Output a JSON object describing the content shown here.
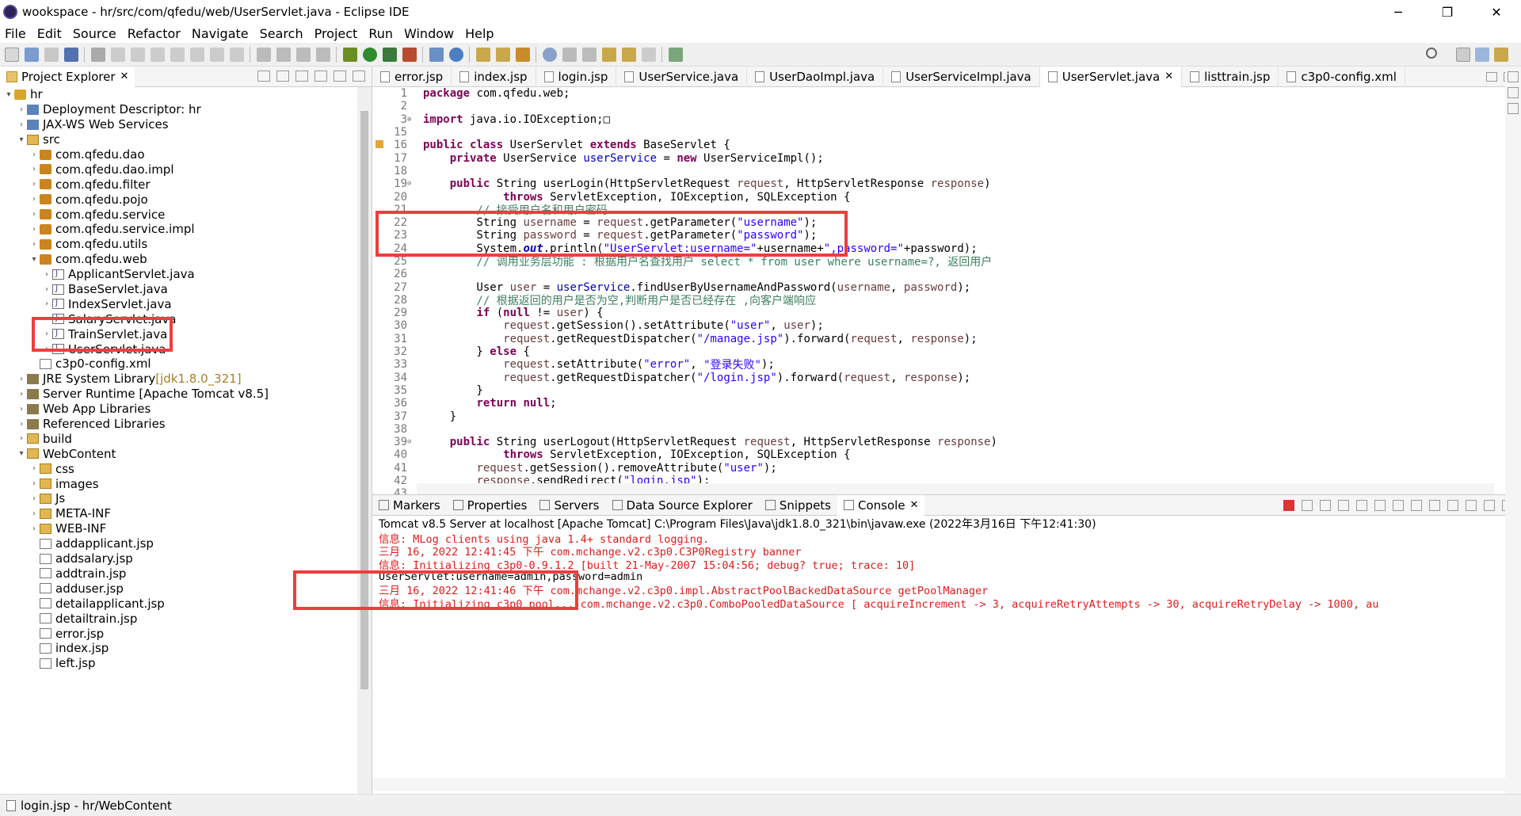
{
  "window": {
    "title": "wookspace - hr/src/com/qfedu/web/UserServlet.java - Eclipse IDE"
  },
  "menu": [
    "File",
    "Edit",
    "Source",
    "Refactor",
    "Navigate",
    "Search",
    "Project",
    "Run",
    "Window",
    "Help"
  ],
  "explorer": {
    "tab_label": "Project Explorer",
    "tree": [
      {
        "label": "hr",
        "icon": "project",
        "arrow": "v"
      },
      {
        "label": "Deployment Descriptor: hr",
        "icon": "web",
        "arrow": ">"
      },
      {
        "label": "JAX-WS Web Services",
        "icon": "web",
        "arrow": ">"
      },
      {
        "label": "src",
        "icon": "folder",
        "arrow": "v"
      },
      {
        "label": "com.qfedu.dao",
        "icon": "package",
        "arrow": ">"
      },
      {
        "label": "com.qfedu.dao.impl",
        "icon": "package",
        "arrow": ">"
      },
      {
        "label": "com.qfedu.filter",
        "icon": "package",
        "arrow": ">"
      },
      {
        "label": "com.qfedu.pojo",
        "icon": "package",
        "arrow": ">"
      },
      {
        "label": "com.qfedu.service",
        "icon": "package",
        "arrow": ">"
      },
      {
        "label": "com.qfedu.service.impl",
        "icon": "package",
        "arrow": ">"
      },
      {
        "label": "com.qfedu.utils",
        "icon": "package",
        "arrow": ">"
      },
      {
        "label": "com.qfedu.web",
        "icon": "package",
        "arrow": "v"
      },
      {
        "label": "ApplicantServlet.java",
        "icon": "java",
        "arrow": ">"
      },
      {
        "label": "BaseServlet.java",
        "icon": "java",
        "arrow": ">"
      },
      {
        "label": "IndexServlet.java",
        "icon": "java",
        "arrow": ">"
      },
      {
        "label": "SalaryServlet.java",
        "icon": "java",
        "arrow": ">"
      },
      {
        "label": "TrainServlet.java",
        "icon": "java",
        "arrow": ">"
      },
      {
        "label": "UserServlet.java",
        "icon": "java",
        "arrow": ">"
      },
      {
        "label": "c3p0-config.xml",
        "icon": "file",
        "arrow": ""
      },
      {
        "label": "JRE System Library",
        "extra": "[jdk1.8.0_321]",
        "icon": "library",
        "arrow": ">"
      },
      {
        "label": "Server Runtime [Apache Tomcat v8.5]",
        "icon": "library",
        "arrow": ">"
      },
      {
        "label": "Web App Libraries",
        "icon": "library",
        "arrow": ">"
      },
      {
        "label": "Referenced Libraries",
        "icon": "library",
        "arrow": ">"
      },
      {
        "label": "build",
        "icon": "folder",
        "arrow": ">"
      },
      {
        "label": "WebContent",
        "icon": "folder",
        "arrow": "v"
      },
      {
        "label": "css",
        "icon": "folder",
        "arrow": ">"
      },
      {
        "label": "images",
        "icon": "folder",
        "arrow": ">"
      },
      {
        "label": "Js",
        "icon": "folder",
        "arrow": ">"
      },
      {
        "label": "META-INF",
        "icon": "folder",
        "arrow": ">"
      },
      {
        "label": "WEB-INF",
        "icon": "folder",
        "arrow": ">"
      },
      {
        "label": "addapplicant.jsp",
        "icon": "file",
        "arrow": ""
      },
      {
        "label": "addsalary.jsp",
        "icon": "file",
        "arrow": ""
      },
      {
        "label": "addtrain.jsp",
        "icon": "file",
        "arrow": ""
      },
      {
        "label": "adduser.jsp",
        "icon": "file",
        "arrow": ""
      },
      {
        "label": "detailapplicant.jsp",
        "icon": "file",
        "arrow": ""
      },
      {
        "label": "detailtrain.jsp",
        "icon": "file",
        "arrow": ""
      },
      {
        "label": "error.jsp",
        "icon": "file",
        "arrow": ""
      },
      {
        "label": "index.jsp",
        "icon": "file",
        "arrow": ""
      },
      {
        "label": "left.jsp",
        "icon": "file",
        "arrow": ""
      }
    ]
  },
  "editor": {
    "tabs": [
      {
        "label": "error.jsp",
        "active": false
      },
      {
        "label": "index.jsp",
        "active": false
      },
      {
        "label": "login.jsp",
        "active": false
      },
      {
        "label": "UserService.java",
        "active": false
      },
      {
        "label": "UserDaoImpl.java",
        "active": false
      },
      {
        "label": "UserServiceImpl.java",
        "active": false
      },
      {
        "label": "UserServlet.java",
        "active": true
      },
      {
        "label": "listtrain.jsp",
        "active": false
      },
      {
        "label": "c3p0-config.xml",
        "active": false
      }
    ],
    "lines": [
      {
        "n": "1",
        "tokens": [
          [
            "kw",
            "package"
          ],
          [
            "ct",
            " com.qfedu.web;"
          ]
        ]
      },
      {
        "n": "2",
        "tokens": []
      },
      {
        "n": "3",
        "fold": "⊕",
        "tokens": [
          [
            "kw",
            "import"
          ],
          [
            "ct",
            " java.io.IOException;"
          ],
          [
            "ct",
            "□"
          ]
        ]
      },
      {
        "n": "15",
        "tokens": []
      },
      {
        "n": "16",
        "tokens": [
          [
            "kw",
            "public class"
          ],
          [
            "ct",
            " UserServlet "
          ],
          [
            "kw",
            "extends"
          ],
          [
            "ct",
            " BaseServlet {"
          ]
        ]
      },
      {
        "n": "17",
        "tokens": [
          [
            "ct",
            "    "
          ],
          [
            "kw",
            "private"
          ],
          [
            "ct",
            " UserService "
          ],
          [
            "fld",
            "userService"
          ],
          [
            "ct",
            " = "
          ],
          [
            "kw",
            "new"
          ],
          [
            "ct",
            " UserServiceImpl();"
          ]
        ]
      },
      {
        "n": "18",
        "tokens": []
      },
      {
        "n": "19",
        "fold": "⊖",
        "tokens": [
          [
            "ct",
            "    "
          ],
          [
            "kw",
            "public"
          ],
          [
            "ct",
            " String userLogin(HttpServletRequest "
          ],
          [
            "var",
            "request"
          ],
          [
            "ct",
            ", HttpServletResponse "
          ],
          [
            "var",
            "response"
          ],
          [
            "ct",
            ")"
          ]
        ]
      },
      {
        "n": "20",
        "tokens": [
          [
            "ct",
            "            "
          ],
          [
            "kw",
            "throws"
          ],
          [
            "ct",
            " ServletException, IOException, SQLException {"
          ]
        ]
      },
      {
        "n": "21",
        "tokens": [
          [
            "cm",
            "        // 接受用户名和用户密码"
          ]
        ]
      },
      {
        "n": "22",
        "tokens": [
          [
            "ct",
            "        String "
          ],
          [
            "var",
            "username"
          ],
          [
            "ct",
            " = "
          ],
          [
            "var",
            "request"
          ],
          [
            "ct",
            ".getParameter("
          ],
          [
            "str",
            "\"username\""
          ],
          [
            "ct",
            ");"
          ]
        ]
      },
      {
        "n": "23",
        "tokens": [
          [
            "ct",
            "        String "
          ],
          [
            "var",
            "password"
          ],
          [
            "ct",
            " = "
          ],
          [
            "var",
            "request"
          ],
          [
            "ct",
            ".getParameter("
          ],
          [
            "str",
            "\"password\""
          ],
          [
            "ct",
            ");"
          ]
        ]
      },
      {
        "n": "24",
        "tokens": [
          [
            "ct",
            "        System."
          ],
          [
            "static",
            "out"
          ],
          [
            "ct",
            ".println("
          ],
          [
            "str",
            "\"UserServlet:username=\""
          ],
          [
            "ct",
            "+username+"
          ],
          [
            "str",
            "\",password=\""
          ],
          [
            "ct",
            "+password);"
          ]
        ]
      },
      {
        "n": "25",
        "tokens": [
          [
            "cm",
            "        // 调用业务层功能 : 根据用户名查找用户 select * from user where username=?, 返回用户"
          ]
        ]
      },
      {
        "n": "26",
        "tokens": []
      },
      {
        "n": "27",
        "tokens": [
          [
            "ct",
            "        User "
          ],
          [
            "var",
            "user"
          ],
          [
            "ct",
            " = "
          ],
          [
            "fld",
            "userService"
          ],
          [
            "ct",
            ".findUserByUsernameAndPassword("
          ],
          [
            "var",
            "username"
          ],
          [
            "ct",
            ", "
          ],
          [
            "var",
            "password"
          ],
          [
            "ct",
            ");"
          ]
        ]
      },
      {
        "n": "28",
        "tokens": [
          [
            "cm",
            "        // 根据返回的用户是否为空,判断用户是否已经存在 ,向客户端响应"
          ]
        ]
      },
      {
        "n": "29",
        "tokens": [
          [
            "ct",
            "        "
          ],
          [
            "kw",
            "if"
          ],
          [
            "ct",
            " ("
          ],
          [
            "kw",
            "null"
          ],
          [
            "ct",
            " != "
          ],
          [
            "var",
            "user"
          ],
          [
            "ct",
            ") {"
          ]
        ]
      },
      {
        "n": "30",
        "tokens": [
          [
            "ct",
            "            "
          ],
          [
            "var",
            "request"
          ],
          [
            "ct",
            ".getSession().setAttribute("
          ],
          [
            "str",
            "\"user\""
          ],
          [
            "ct",
            ", "
          ],
          [
            "var",
            "user"
          ],
          [
            "ct",
            ");"
          ]
        ]
      },
      {
        "n": "31",
        "tokens": [
          [
            "ct",
            "            "
          ],
          [
            "var",
            "request"
          ],
          [
            "ct",
            ".getRequestDispatcher("
          ],
          [
            "str",
            "\"/manage.jsp\""
          ],
          [
            "ct",
            ").forward("
          ],
          [
            "var",
            "request"
          ],
          [
            "ct",
            ", "
          ],
          [
            "var",
            "response"
          ],
          [
            "ct",
            ");"
          ]
        ]
      },
      {
        "n": "32",
        "tokens": [
          [
            "ct",
            "        } "
          ],
          [
            "kw",
            "else"
          ],
          [
            "ct",
            " {"
          ]
        ]
      },
      {
        "n": "33",
        "tokens": [
          [
            "ct",
            "            "
          ],
          [
            "var",
            "request"
          ],
          [
            "ct",
            ".setAttribute("
          ],
          [
            "str",
            "\"error\""
          ],
          [
            "ct",
            ", "
          ],
          [
            "str",
            "\"登录失败\""
          ],
          [
            "ct",
            ");"
          ]
        ]
      },
      {
        "n": "34",
        "tokens": [
          [
            "ct",
            "            "
          ],
          [
            "var",
            "request"
          ],
          [
            "ct",
            ".getRequestDispatcher("
          ],
          [
            "str",
            "\"/login.jsp\""
          ],
          [
            "ct",
            ").forward("
          ],
          [
            "var",
            "request"
          ],
          [
            "ct",
            ", "
          ],
          [
            "var",
            "response"
          ],
          [
            "ct",
            ");"
          ]
        ]
      },
      {
        "n": "35",
        "tokens": [
          [
            "ct",
            "        }"
          ]
        ]
      },
      {
        "n": "36",
        "tokens": [
          [
            "ct",
            "        "
          ],
          [
            "kw",
            "return null"
          ],
          [
            "ct",
            ";"
          ]
        ]
      },
      {
        "n": "37",
        "tokens": [
          [
            "ct",
            "    }"
          ]
        ]
      },
      {
        "n": "38",
        "tokens": []
      },
      {
        "n": "39",
        "fold": "⊖",
        "tokens": [
          [
            "ct",
            "    "
          ],
          [
            "kw",
            "public"
          ],
          [
            "ct",
            " String userLogout(HttpServletRequest "
          ],
          [
            "var",
            "request"
          ],
          [
            "ct",
            ", HttpServletResponse "
          ],
          [
            "var",
            "response"
          ],
          [
            "ct",
            ")"
          ]
        ]
      },
      {
        "n": "40",
        "tokens": [
          [
            "ct",
            "            "
          ],
          [
            "kw",
            "throws"
          ],
          [
            "ct",
            " ServletException, IOException, SQLException {"
          ]
        ]
      },
      {
        "n": "41",
        "tokens": [
          [
            "ct",
            "        "
          ],
          [
            "var",
            "request"
          ],
          [
            "ct",
            ".getSession().removeAttribute("
          ],
          [
            "str",
            "\"user\""
          ],
          [
            "ct",
            ");"
          ]
        ]
      },
      {
        "n": "42",
        "tokens": [
          [
            "ct",
            "        "
          ],
          [
            "var",
            "response"
          ],
          [
            "ct",
            ".sendRedirect("
          ],
          [
            "str",
            "\"login.jsp\""
          ],
          [
            "ct",
            ");"
          ]
        ]
      },
      {
        "n": "43",
        "tokens": [
          [
            "ct",
            "        "
          ],
          [
            "kw",
            "return null"
          ],
          [
            "ct",
            ";"
          ]
        ]
      }
    ]
  },
  "console_panel": {
    "tabs": [
      {
        "label": "Markers",
        "active": false
      },
      {
        "label": "Properties",
        "active": false
      },
      {
        "label": "Servers",
        "active": false
      },
      {
        "label": "Data Source Explorer",
        "active": false
      },
      {
        "label": "Snippets",
        "active": false
      },
      {
        "label": "Console",
        "active": true
      }
    ],
    "header": "Tomcat v8.5 Server at localhost [Apache Tomcat] C:\\Program Files\\Java\\jdk1.8.0_321\\bin\\javaw.exe  (2022年3月16日 下午12:41:30)",
    "lines": [
      {
        "text": "信息: MLog clients using java 1.4+ standard logging.",
        "color": "red"
      },
      {
        "text": "三月 16, 2022 12:41:45 下午 com.mchange.v2.c3p0.C3P0Registry banner",
        "color": "red"
      },
      {
        "text": "信息: Initializing c3p0-0.9.1.2 [built 21-May-2007 15:04:56; debug? true; trace: 10]",
        "color": "red"
      },
      {
        "text": "UserServlet:username=admin,password=admin",
        "color": "black"
      },
      {
        "text": "三月 16, 2022 12:41:46 下午 com.mchange.v2.c3p0.impl.AbstractPoolBackedDataSource getPoolManager",
        "color": "red"
      },
      {
        "text": "信息: Initializing c3p0 pool... com.mchange.v2.c3p0.ComboPooledDataSource [ acquireIncrement -> 3, acquireRetryAttempts -> 30, acquireRetryDelay -> 1000, au",
        "color": "red"
      }
    ]
  },
  "status": {
    "text": "login.jsp - hr/WebContent"
  },
  "colors": {
    "highlight": "#f03d3d",
    "keyword": "#7f0055",
    "string": "#2a00ff",
    "comment": "#3f7f5f",
    "console_error": "#e01b1b"
  }
}
